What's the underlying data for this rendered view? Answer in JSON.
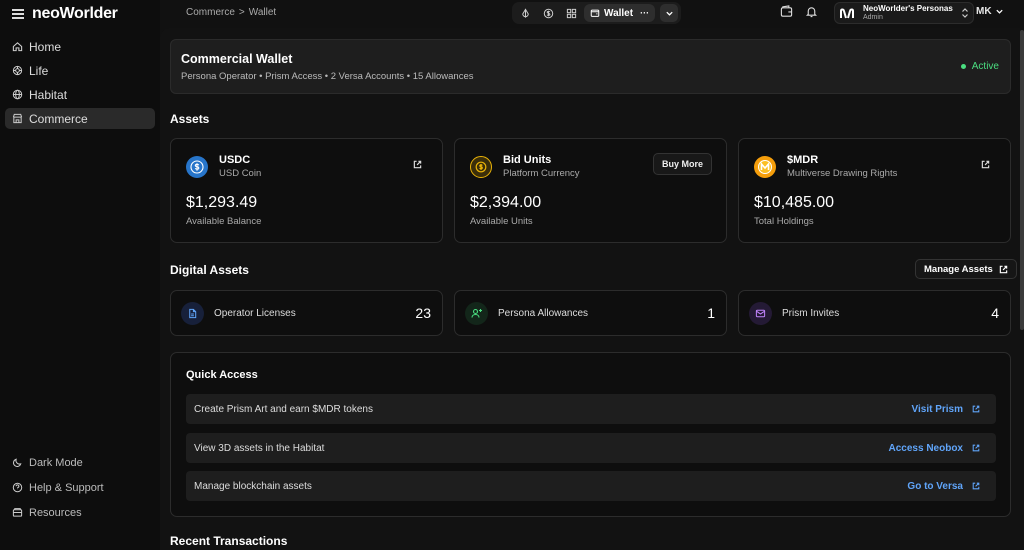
{
  "brand": {
    "logo_text": "neoWorlder"
  },
  "sidebar": {
    "items": [
      {
        "label": "Home",
        "icon": "home-icon"
      },
      {
        "label": "Life",
        "icon": "life-icon"
      },
      {
        "label": "Habitat",
        "icon": "globe-icon"
      },
      {
        "label": "Commerce",
        "icon": "store-icon",
        "active": true
      }
    ],
    "bottom": [
      {
        "label": "Dark Mode",
        "icon": "moon-icon"
      },
      {
        "label": "Help & Support",
        "icon": "help-icon"
      },
      {
        "label": "Resources",
        "icon": "resources-icon"
      }
    ]
  },
  "breadcrumb": {
    "parent": "Commerce",
    "separator": ">",
    "current": "Wallet"
  },
  "toolbar": {
    "active_label": "Wallet",
    "more_label": "···"
  },
  "persona": {
    "name": "NeoWorlder's Personas",
    "role": "Admin"
  },
  "user": {
    "initials": "MK"
  },
  "banner": {
    "title": "Commercial Wallet",
    "subtitle": "Persona Operator • Prism Access • 2 Versa Accounts • 15 Allowances",
    "status": "Active",
    "status_color": "#4ade80"
  },
  "assets": {
    "title": "Assets",
    "cards": [
      {
        "name": "USDC",
        "desc": "USD Coin",
        "value": "$1,293.49",
        "value_label": "Available Balance",
        "icon": "usdc-coin-icon",
        "color": "#2775ca"
      },
      {
        "name": "Bid Units",
        "desc": "Platform Currency",
        "value": "$2,394.00",
        "value_label": "Available Units",
        "icon": "dollar-coin-icon",
        "color": "#eab308",
        "button": "Buy More"
      },
      {
        "name": "$MDR",
        "desc": "Multiverse Drawing Rights",
        "value": "$10,485.00",
        "value_label": "Total Holdings",
        "icon": "mdr-coin-icon",
        "color": "#f59e0b"
      }
    ]
  },
  "digital_assets": {
    "title": "Digital Assets",
    "manage_label": "Manage Assets",
    "cards": [
      {
        "label": "Operator Licenses",
        "count": "23",
        "icon": "document-icon",
        "color": "#60a5fa"
      },
      {
        "label": "Persona Allowances",
        "count": "1",
        "icon": "user-plus-icon",
        "color": "#4ade80"
      },
      {
        "label": "Prism Invites",
        "count": "4",
        "icon": "mail-icon",
        "color": "#c084fc"
      }
    ]
  },
  "quick_access": {
    "title": "Quick Access",
    "rows": [
      {
        "text": "Create Prism Art and earn $MDR tokens",
        "link": "Visit Prism"
      },
      {
        "text": "View 3D assets in the Habitat",
        "link": "Access Neobox"
      },
      {
        "text": "Manage blockchain assets",
        "link": "Go to Versa"
      }
    ]
  },
  "recent": {
    "title": "Recent Transactions"
  }
}
